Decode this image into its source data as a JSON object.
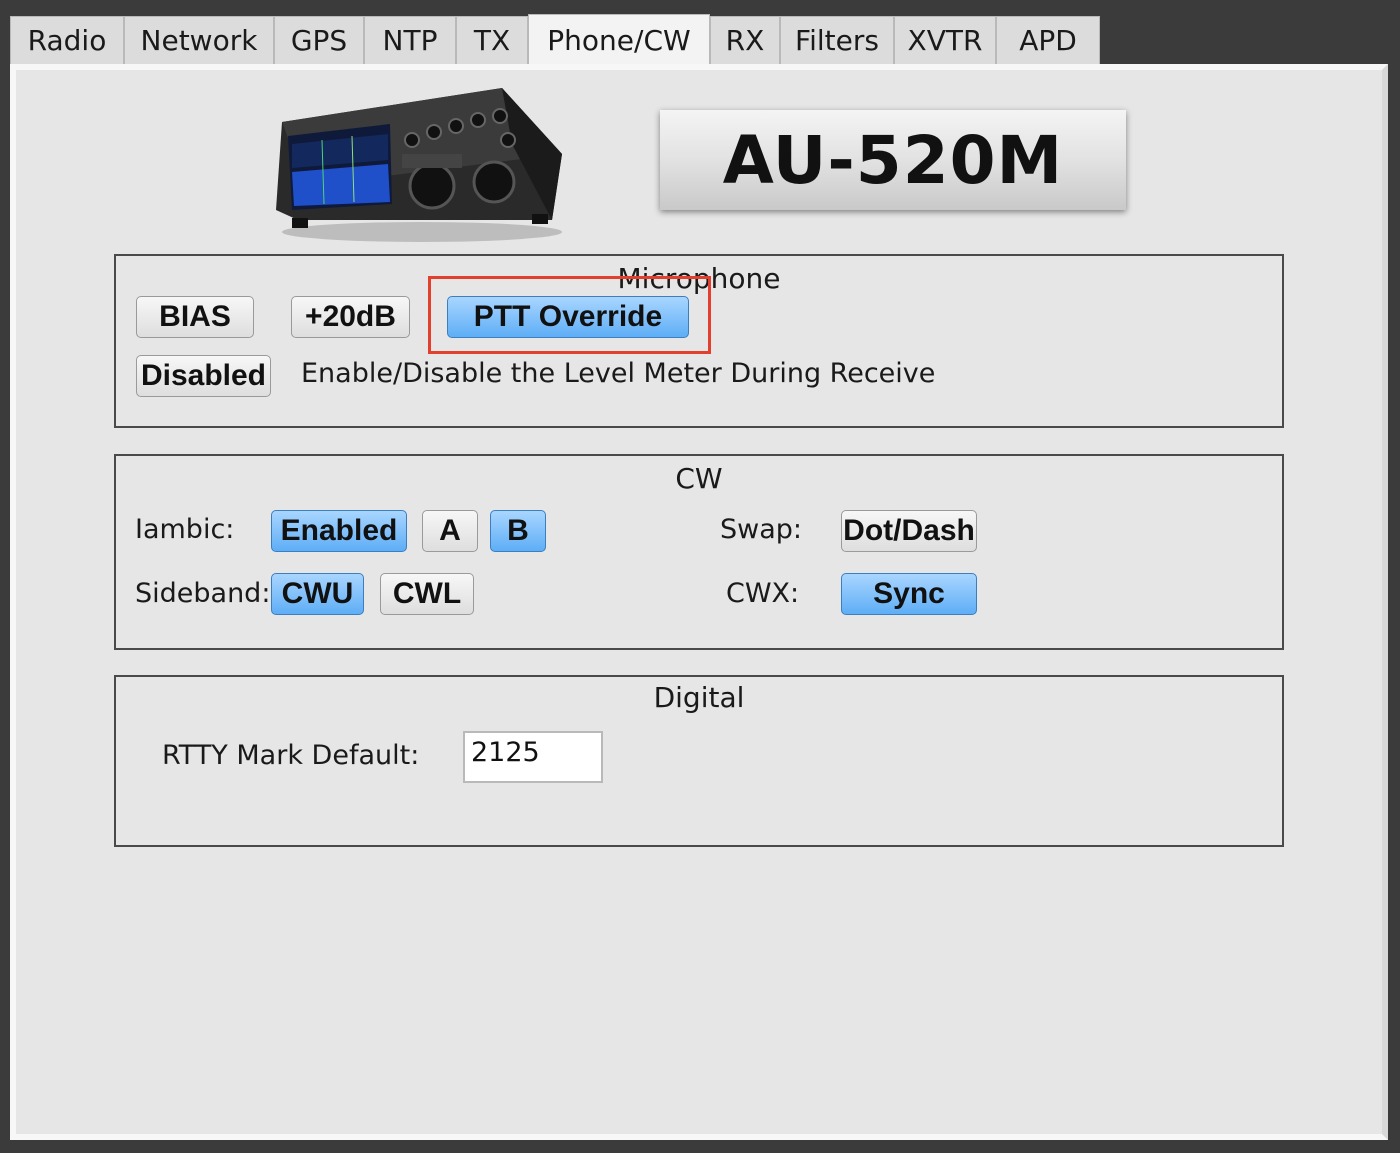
{
  "tabs": [
    {
      "label": "Radio"
    },
    {
      "label": "Network"
    },
    {
      "label": "GPS"
    },
    {
      "label": "NTP"
    },
    {
      "label": "TX"
    },
    {
      "label": "Phone/CW",
      "active": true
    },
    {
      "label": "RX"
    },
    {
      "label": "Filters"
    },
    {
      "label": "XVTR"
    },
    {
      "label": "APD"
    }
  ],
  "header": {
    "model": "AU-520M"
  },
  "microphone": {
    "title": "Microphone",
    "bias_label": "BIAS",
    "boost_label": "+20dB",
    "ptt_override_label": "PTT Override",
    "meter_button_label": "Disabled",
    "meter_description": "Enable/Disable the Level Meter During Receive"
  },
  "cw": {
    "title": "CW",
    "iambic_label": "Iambic:",
    "iambic_enabled_label": "Enabled",
    "mode_a_label": "A",
    "mode_b_label": "B",
    "swap_label": "Swap:",
    "swap_button_label": "Dot/Dash",
    "sideband_label": "Sideband:",
    "cwu_label": "CWU",
    "cwl_label": "CWL",
    "cwx_label": "CWX:",
    "sync_label": "Sync"
  },
  "digital": {
    "title": "Digital",
    "rtty_mark_label": "RTTY Mark Default:",
    "rtty_mark_value": "2125"
  },
  "colors": {
    "accent_on": "#5eaef6",
    "highlight": "#e2402c"
  }
}
